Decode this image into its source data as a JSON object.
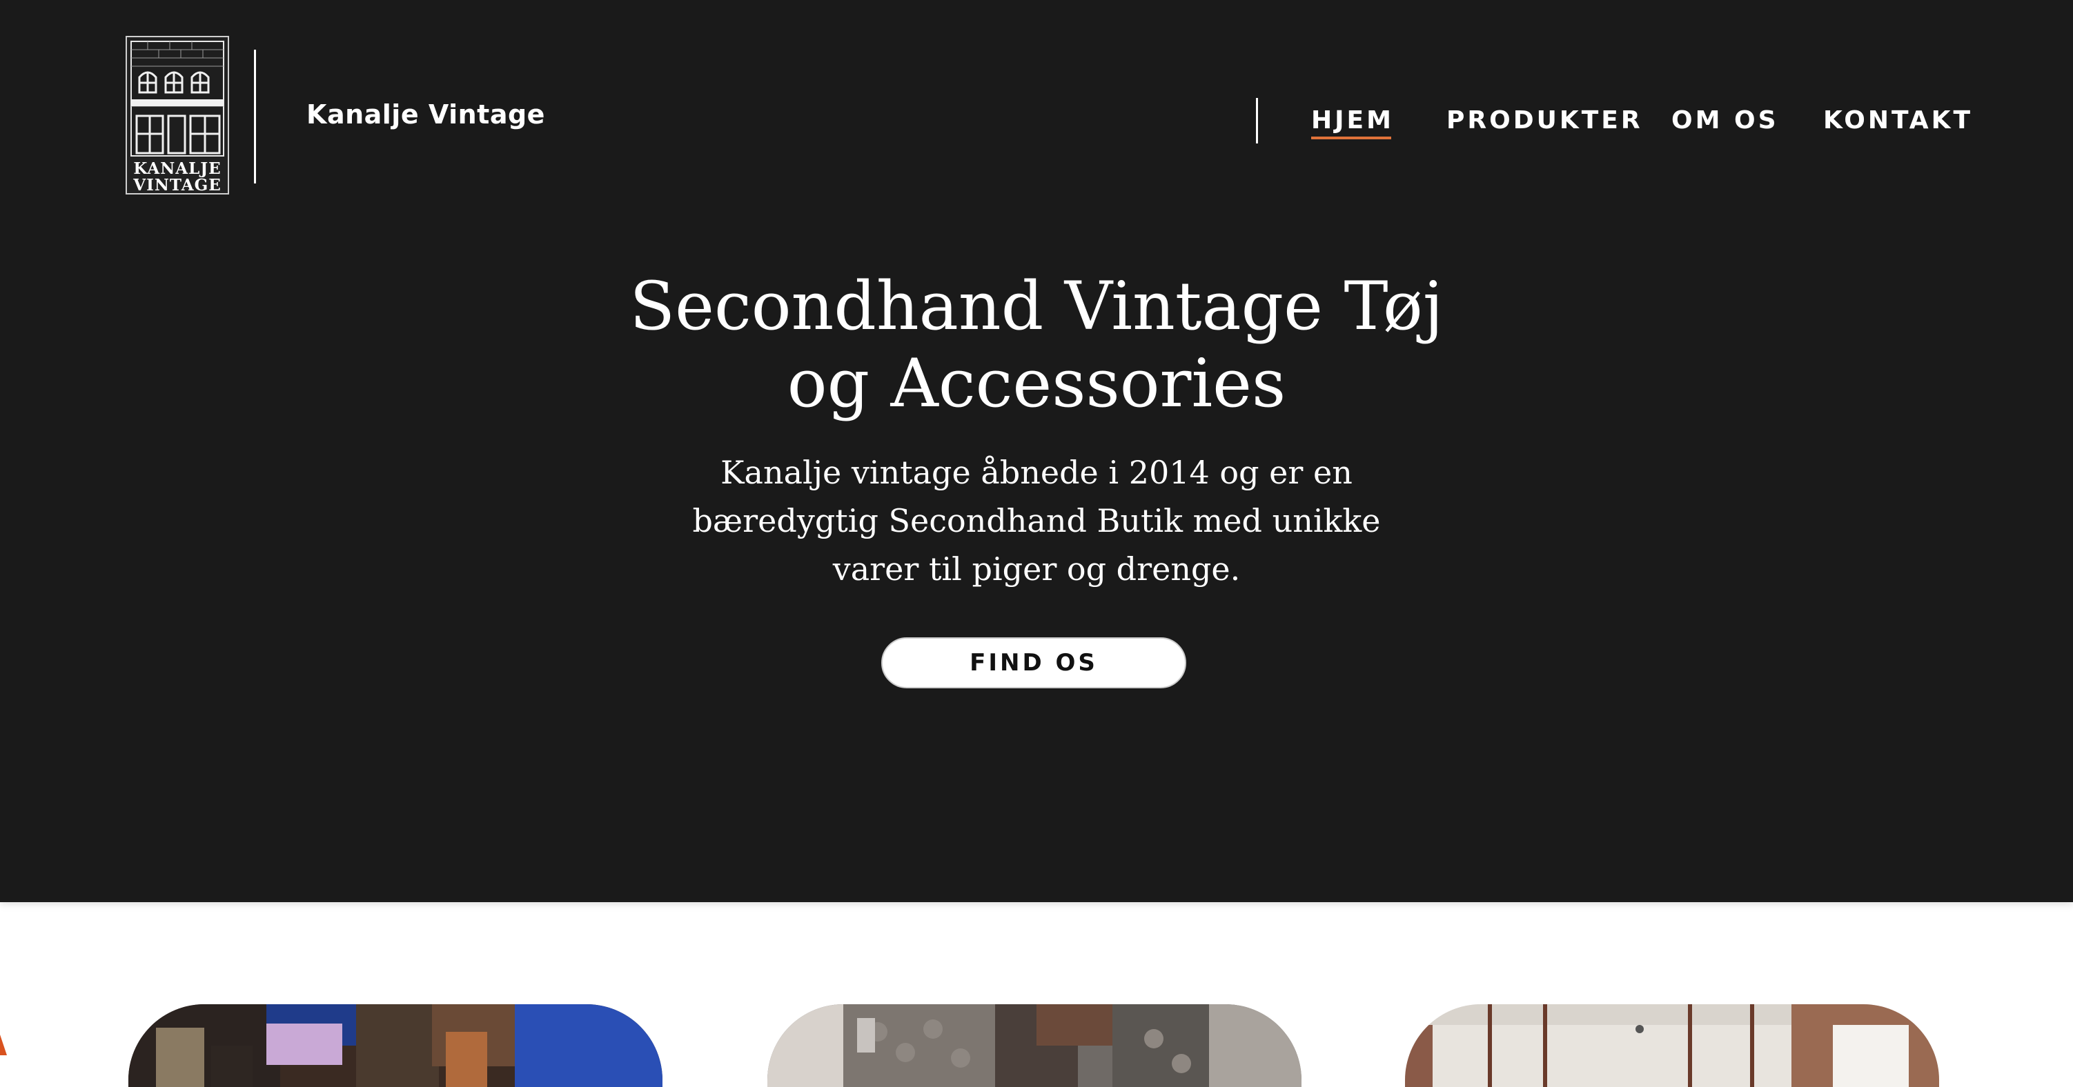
{
  "header": {
    "logo_text": [
      "KANALJE",
      "VINTAGE"
    ],
    "brand_name": "Kanalje Vintage",
    "nav": [
      {
        "label": "HJEM",
        "active": true
      },
      {
        "label": "PRODUKTER",
        "active": false
      },
      {
        "label": "OM OS",
        "active": false
      },
      {
        "label": "KONTAKT",
        "active": false
      }
    ]
  },
  "hero": {
    "title_line1": "Secondhand Vintage Tøj",
    "title_line2": "og Accessories",
    "subtitle_line1": "Kanalje vintage åbnede i 2014 og er en",
    "subtitle_line2": "bæredygtig Secondhand Butik med unikke",
    "subtitle_line3": "varer til piger og drenge.",
    "cta_label": "FIND OS"
  },
  "gallery": {
    "cards": [
      {
        "name": "shop-interior-photo"
      },
      {
        "name": "street-photo"
      },
      {
        "name": "room-photo"
      }
    ]
  },
  "colors": {
    "hero_bg": "#1a1a1a",
    "accent_underline": "#e0733a",
    "page_bg": "#ffffff"
  }
}
